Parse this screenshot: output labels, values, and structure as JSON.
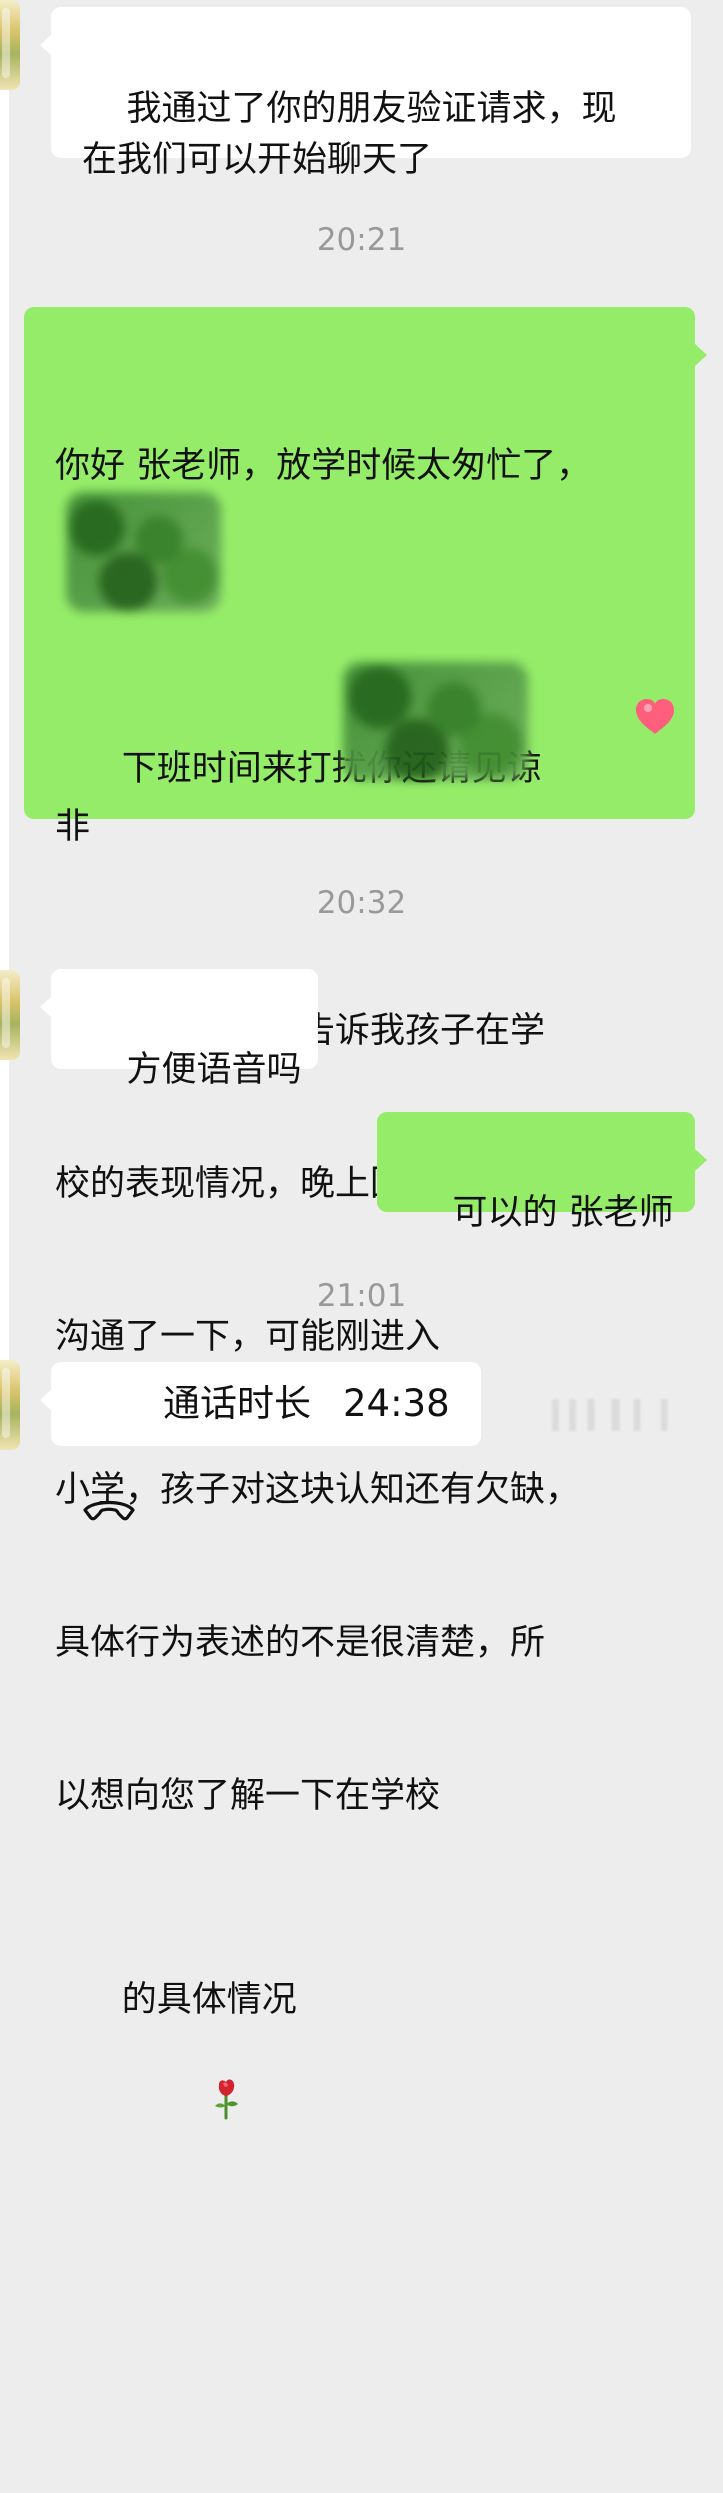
{
  "messages": [
    {
      "type": "incoming",
      "text": "我通过了你的朋友验证请求，现\n在我们可以开始聊天了"
    },
    {
      "type": "time",
      "text": "20:21"
    },
    {
      "type": "outgoing",
      "line1": "你好 张老师，放学时候太匆忙了，",
      "line2_before": "下班时间来打扰你还请见谅",
      "line2_after": "非",
      "line3": "常感谢您能特意告诉我孩子在学",
      "line4": "校的表现情况，晚上回来我也和",
      "line5": "沟通了一下，可能刚进入",
      "line6": "小学，孩子对这块认知还有欠缺，",
      "line7": "具体行为表述的不是很清楚，所",
      "line8": "以想向您了解一下在学校",
      "line9": "的具体情况",
      "emoji_heart": "heart-emoji",
      "emoji_rose": "rose-emoji"
    },
    {
      "type": "time",
      "text": "20:32"
    },
    {
      "type": "incoming",
      "text": "方便语音吗"
    },
    {
      "type": "outgoing",
      "text": "可以的 张老师"
    },
    {
      "type": "time",
      "text": "21:01"
    },
    {
      "type": "call",
      "label": "通话时长",
      "duration": "24:38",
      "icon": "phone-icon"
    }
  ],
  "colors": {
    "background": "#ededed",
    "incoming_bubble": "#ffffff",
    "outgoing_bubble": "#95ec69",
    "timestamp": "#999999"
  }
}
